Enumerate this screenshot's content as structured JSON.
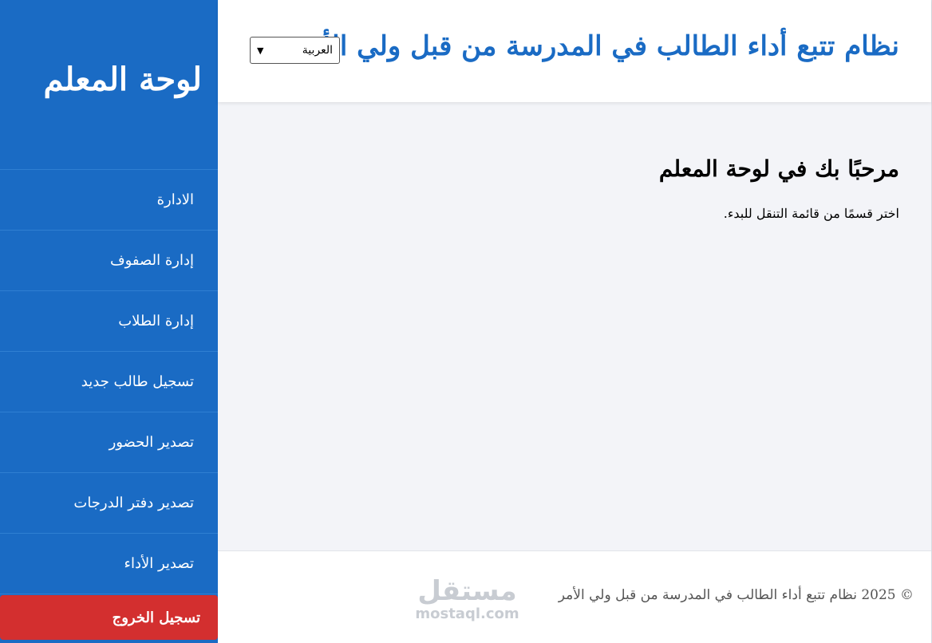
{
  "header": {
    "title": "نظام تتبع أداء الطالب في المدرسة من قبل ولي الأمر",
    "language_select": {
      "selected": "العربية"
    }
  },
  "sidebar": {
    "title": "لوحة المعلم",
    "items": [
      {
        "label": "الادارة"
      },
      {
        "label": "إدارة الصفوف"
      },
      {
        "label": "إدارة الطلاب"
      },
      {
        "label": "تسجيل طالب جديد"
      },
      {
        "label": "تصدير الحضور"
      },
      {
        "label": "تصدير دفتر الدرجات"
      },
      {
        "label": "تصدير الأداء"
      }
    ],
    "logout_label": "تسجيل الخروج"
  },
  "main": {
    "welcome_heading": "مرحبًا بك في لوحة المعلم",
    "hint": "اختر قسمًا من قائمة التنقل للبدء."
  },
  "footer": {
    "copyright": "© 2025 نظام تتبع أداء الطالب في المدرسة من قبل ولي الأمر",
    "watermark_ar": "مستقل",
    "watermark_en": "mostaql.com"
  },
  "colors": {
    "primary": "#1a6bc4",
    "logout": "#d32f2f",
    "background": "#f3f4f8"
  }
}
